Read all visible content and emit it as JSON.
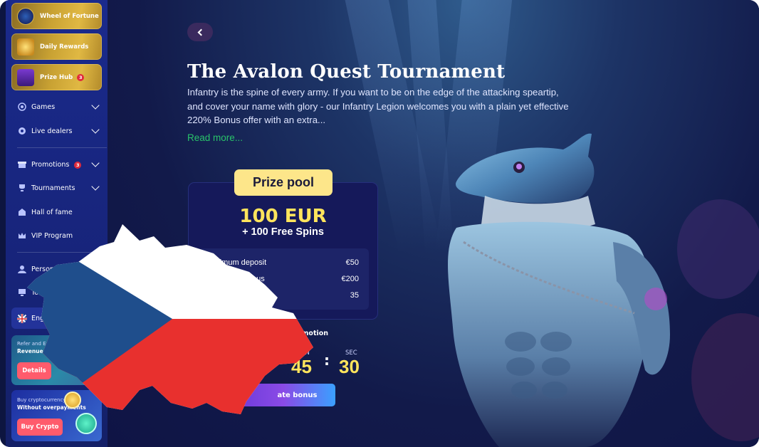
{
  "sidebar": {
    "promo_buttons": [
      {
        "label": "Wheel of Fortune"
      },
      {
        "label": "Daily Rewards"
      },
      {
        "label": "Prize Hub",
        "badge": "3"
      }
    ],
    "nav": {
      "games": "Games",
      "live_dealers": "Live dealers",
      "promotions": "Promotions",
      "promotions_badge": "3",
      "tournaments": "Tournaments",
      "hall_of_fame": "Hall of fame",
      "vip_program": "VIP Program",
      "personal_details": "Personal detai",
      "tournaments_2": "Tour",
      "language": "Eng"
    },
    "refer_card": {
      "small": "Refer and Earn",
      "big": "Revenue until 30",
      "button": "Details"
    },
    "crypto_card": {
      "small": "Buy cryptocurrency",
      "big": "Without overpayments",
      "button": "Buy Crypto"
    }
  },
  "tournament": {
    "title": "The Avalon Quest Tournament",
    "description": "Infantry is the spine of every army. If you want to be on the edge of the attacking speartip, and cover your name with glory - our Infantry Legion welcomes you with a plain yet effective 220% Bonus offer with an extra...",
    "read_more": "Read more...",
    "prize_pool_label": "Prize pool",
    "prize_amount": "100 EUR",
    "prize_spins": "+ 100 Free Spins",
    "rows": [
      {
        "label": "Minimum deposit",
        "value": "€50"
      },
      {
        "label": "Maximum bonus",
        "value": "€200"
      },
      {
        "label": "",
        "value": "35"
      }
    ],
    "promo_ends_label": "omotion",
    "timer": {
      "min_label": "IN",
      "min_value": "45",
      "sec_label": "SEC",
      "sec_value": "30"
    },
    "activate_button": "ate bonus"
  },
  "colors": {
    "sidebar_bg": "#1a2a8c",
    "gold": "#c9a233",
    "accent_green": "#29c36a",
    "prize_yellow": "#ffe45c",
    "cz_blue": "#1f4e8c",
    "cz_red": "#e8302e",
    "cz_white": "#ffffff"
  }
}
